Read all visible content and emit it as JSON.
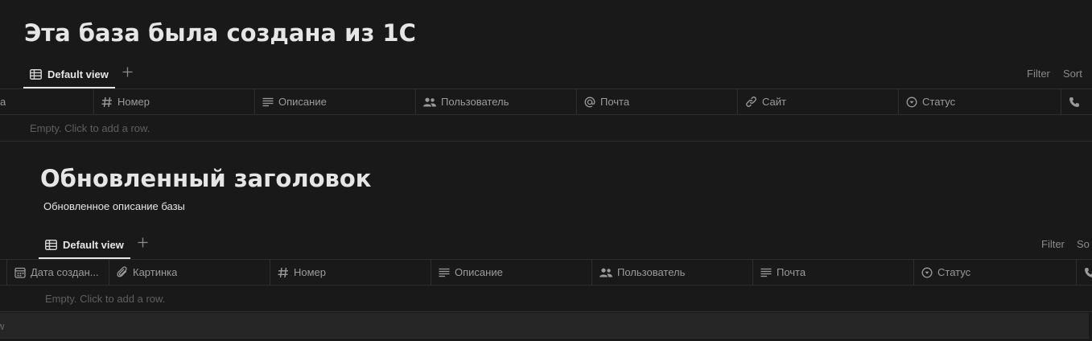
{
  "database1": {
    "title": "Эта база была создана из 1С",
    "view_tab": "Default view",
    "filter_label": "Filter",
    "sort_label": "Sort",
    "columns": [
      {
        "label": "а",
        "icon": "none"
      },
      {
        "label": "Номер",
        "icon": "hash-icon"
      },
      {
        "label": "Описание",
        "icon": "text-lines-icon"
      },
      {
        "label": "Пользователь",
        "icon": "people-icon"
      },
      {
        "label": "Почта",
        "icon": "at-sign-icon"
      },
      {
        "label": "Сайт",
        "icon": "link-icon"
      },
      {
        "label": "Статус",
        "icon": "status-icon"
      },
      {
        "label": "",
        "icon": "phone-icon"
      }
    ],
    "empty_text": "Empty. Click to add a row."
  },
  "database2": {
    "title": "Обновленный заголовок",
    "description": "Обновленное описание базы",
    "view_tab": "Default view",
    "filter_label": "Filter",
    "sort_label": "So",
    "columns": [
      {
        "label": "Дата создан...",
        "icon": "calendar-icon"
      },
      {
        "label": "Картинка",
        "icon": "paperclip-icon"
      },
      {
        "label": "Номер",
        "icon": "hash-icon"
      },
      {
        "label": "Описание",
        "icon": "text-lines-icon"
      },
      {
        "label": "Пользователь",
        "icon": "people-icon"
      },
      {
        "label": "Почта",
        "icon": "text-lines-icon"
      },
      {
        "label": "Статус",
        "icon": "status-icon"
      },
      {
        "label": "",
        "icon": "phone-icon"
      }
    ],
    "empty_text": "Empty. Click to add a row."
  },
  "bottom_bar": {
    "text": "w"
  },
  "colors": {
    "background": "#191919",
    "border": "#2f2f2f",
    "muted_text": "#9b9b9b",
    "primary_text": "#e6e6e6"
  }
}
